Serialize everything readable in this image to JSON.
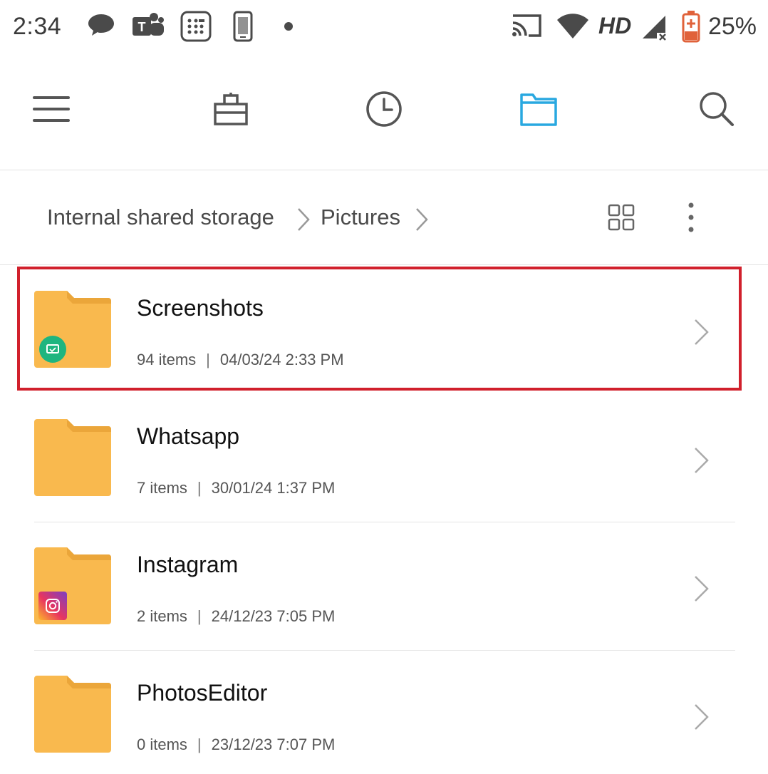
{
  "status": {
    "time": "2:34",
    "network": "HD",
    "battery": "25%",
    "icons": [
      "message-icon",
      "teams-icon",
      "calculator-icon",
      "phone-icon",
      "dot-icon",
      "cast-icon",
      "wifi-icon",
      "signal-icon",
      "battery-icon"
    ]
  },
  "toolbar": {
    "icons": [
      "menu-icon",
      "toolbox-icon",
      "recent-icon",
      "folder-icon",
      "search-icon"
    ],
    "active_color": "#29a8e0"
  },
  "breadcrumb": {
    "items": [
      "Internal shared storage",
      "Pictures"
    ]
  },
  "folders": [
    {
      "name": "Screenshots",
      "items": "94 items",
      "date": "04/03/24 2:33 PM",
      "badge": "screenshot-badge-icon",
      "highlighted": true
    },
    {
      "name": "Whatsapp",
      "items": "7 items",
      "date": "30/01/24 1:37 PM",
      "badge": ""
    },
    {
      "name": "Instagram",
      "items": "2 items",
      "date": "24/12/23 7:05 PM",
      "badge": "instagram-badge-icon"
    },
    {
      "name": "PhotosEditor",
      "items": "0 items",
      "date": "23/12/23 7:07 PM",
      "badge": ""
    }
  ],
  "colors": {
    "folder": "#f9b94e",
    "folder_tab": "#eba63a",
    "highlight": "#d1202c"
  }
}
